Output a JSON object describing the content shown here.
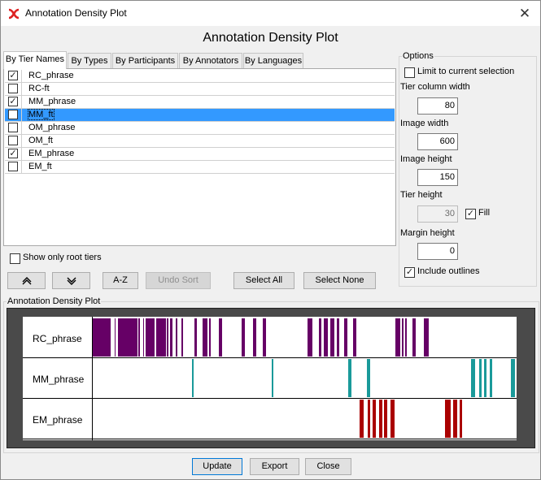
{
  "window": {
    "title": "Annotation Density Plot",
    "close_icon": "close-icon",
    "app_icon": "elan-app-icon"
  },
  "heading": "Annotation Density Plot",
  "tabs": [
    "By Tier Names",
    "By Types",
    "By Participants",
    "By Annotators",
    "By Languages"
  ],
  "tiers": [
    {
      "name": "RC_phrase",
      "checked": true,
      "selected": false
    },
    {
      "name": "RC-ft",
      "checked": false,
      "selected": false
    },
    {
      "name": "MM_phrase",
      "checked": true,
      "selected": false
    },
    {
      "name": "MM_ft",
      "checked": false,
      "selected": true
    },
    {
      "name": "OM_phrase",
      "checked": false,
      "selected": false
    },
    {
      "name": "OM_ft",
      "checked": false,
      "selected": false
    },
    {
      "name": "EM_phrase",
      "checked": true,
      "selected": false
    },
    {
      "name": "EM_ft",
      "checked": false,
      "selected": false
    }
  ],
  "show_root": {
    "label": "Show only root tiers",
    "checked": false
  },
  "buttons": {
    "move_up": "▲",
    "move_down": "▼",
    "az": "A-Z",
    "undo_sort": "Undo Sort",
    "select_all": "Select All",
    "select_none": "Select None",
    "update": "Update",
    "export": "Export",
    "close": "Close"
  },
  "options": {
    "legend": "Options",
    "limit_label": "Limit to current selection",
    "limit_checked": false,
    "tier_col_label": "Tier column width",
    "tier_col_value": "80",
    "image_width_label": "Image width",
    "image_width_value": "600",
    "image_height_label": "Image height",
    "image_height_value": "150",
    "tier_height_label": "Tier height",
    "tier_height_value": "30",
    "fill_label": "Fill",
    "fill_checked": true,
    "margin_label": "Margin height",
    "margin_value": "0",
    "outlines_label": "Include outlines",
    "outlines_checked": true
  },
  "plot": {
    "legend": "Annotation Density Plot",
    "tiers": [
      {
        "name": "RC_phrase",
        "color": "#660066"
      },
      {
        "name": "MM_phrase",
        "color": "#1a9a9a"
      },
      {
        "name": "EM_phrase",
        "color": "#aa0000"
      }
    ]
  }
}
